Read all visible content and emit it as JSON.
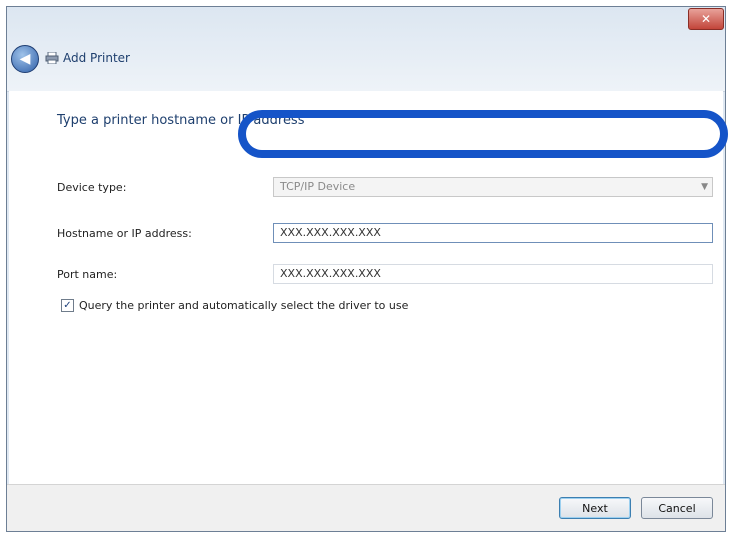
{
  "window": {
    "close_symbol": "✕",
    "title": "Add Printer"
  },
  "header": {
    "back_symbol": "◀",
    "heading": "Type a printer hostname or IP address"
  },
  "form": {
    "device_type": {
      "label": "Device type:",
      "value": "TCP/IP Device"
    },
    "hostname": {
      "label": "Hostname or IP address:",
      "value": "XXX.XXX.XXX.XXX"
    },
    "port_name": {
      "label": "Port name:",
      "value": "XXX.XXX.XXX.XXX"
    },
    "query_checkbox": {
      "checked": true,
      "check_symbol": "✓",
      "label": "Query the printer and automatically select the driver to use"
    }
  },
  "footer": {
    "next_label": "Next",
    "cancel_label": "Cancel"
  },
  "colors": {
    "highlight": "#1554c8"
  }
}
